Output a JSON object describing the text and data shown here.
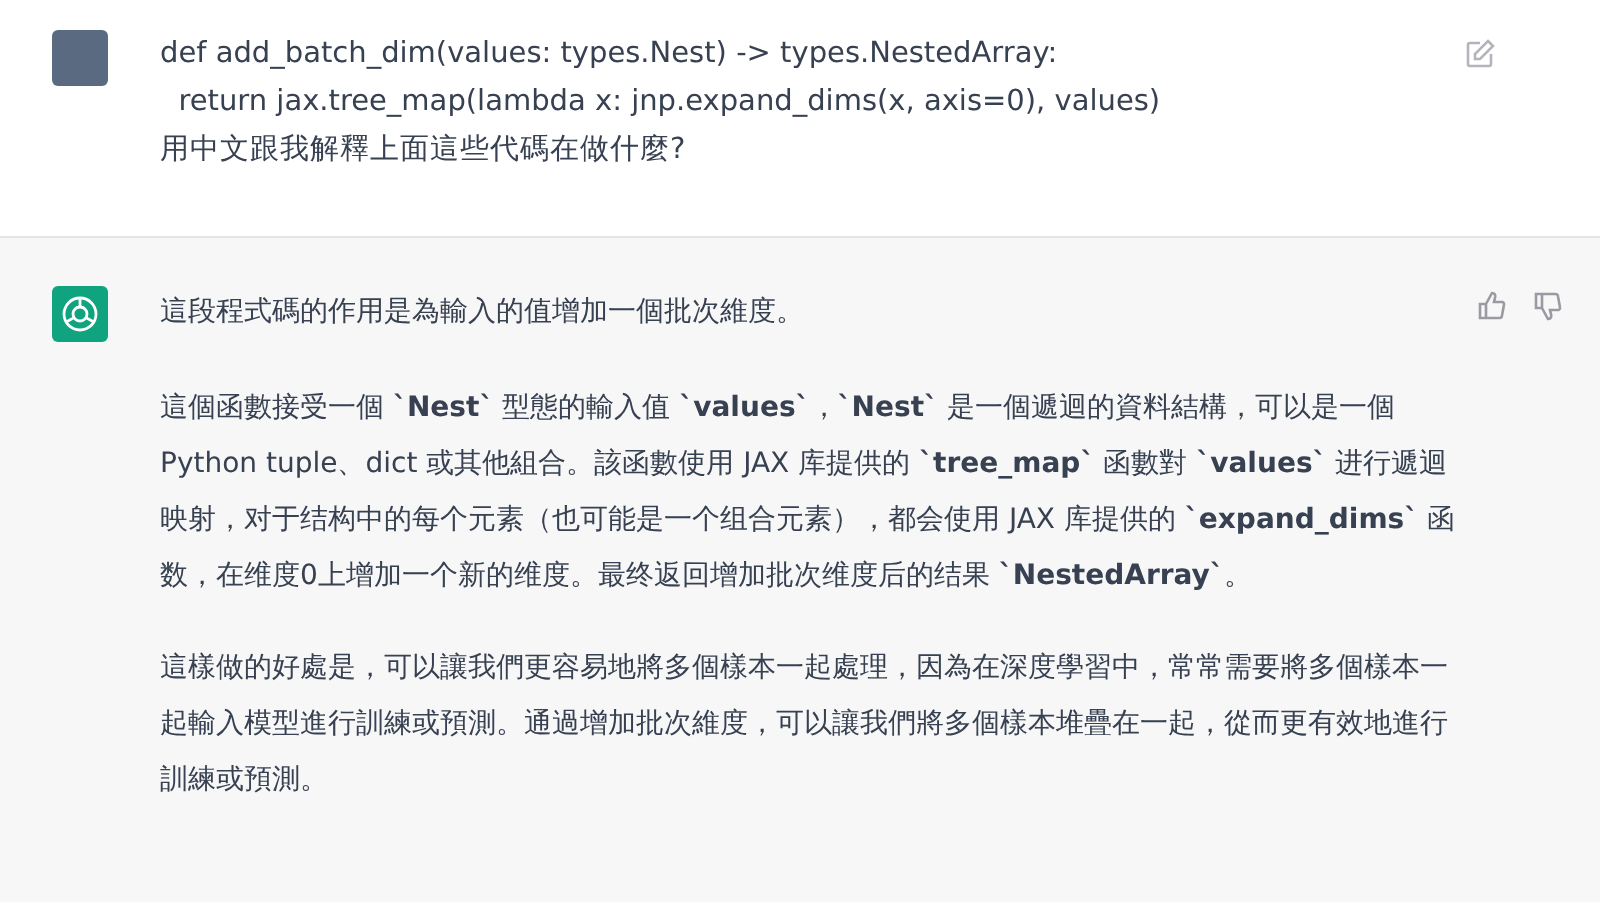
{
  "user_message": {
    "lines": [
      "def add_batch_dim(values: types.Nest) -> types.NestedArray:",
      "  return jax.tree_map(lambda x: jnp.expand_dims(x, axis=0), values)",
      "用中文跟我解釋上面這些代碼在做什麼?"
    ]
  },
  "assistant_message": {
    "paragraphs": [
      "這段程式碼的作用是為輸入的值增加一個批次維度。",
      "這個函數接受一個 **`Nest`** 型態的輸入值 **`values`**，**`Nest`** 是一個遞迴的資料結構，可以是一個 Python tuple、dict 或其他組合。該函數使用 JAX 库提供的 **`tree_map`** 函數對 **`values`** 进行遞迴映射，对于结构中的每个元素（也可能是一个组合元素），都会使用 JAX 库提供的 **`expand_dims`** 函数，在维度0上增加一个新的维度。最终返回增加批次维度后的结果 **`NestedArray`**。",
      "這樣做的好處是，可以讓我們更容易地將多個樣本一起處理，因為在深度學習中，常常需要將多個樣本一起輸入模型進行訓練或預測。通過增加批次維度，可以讓我們將多個樣本堆疊在一起，從而更有效地進行訓練或預測。"
    ]
  }
}
